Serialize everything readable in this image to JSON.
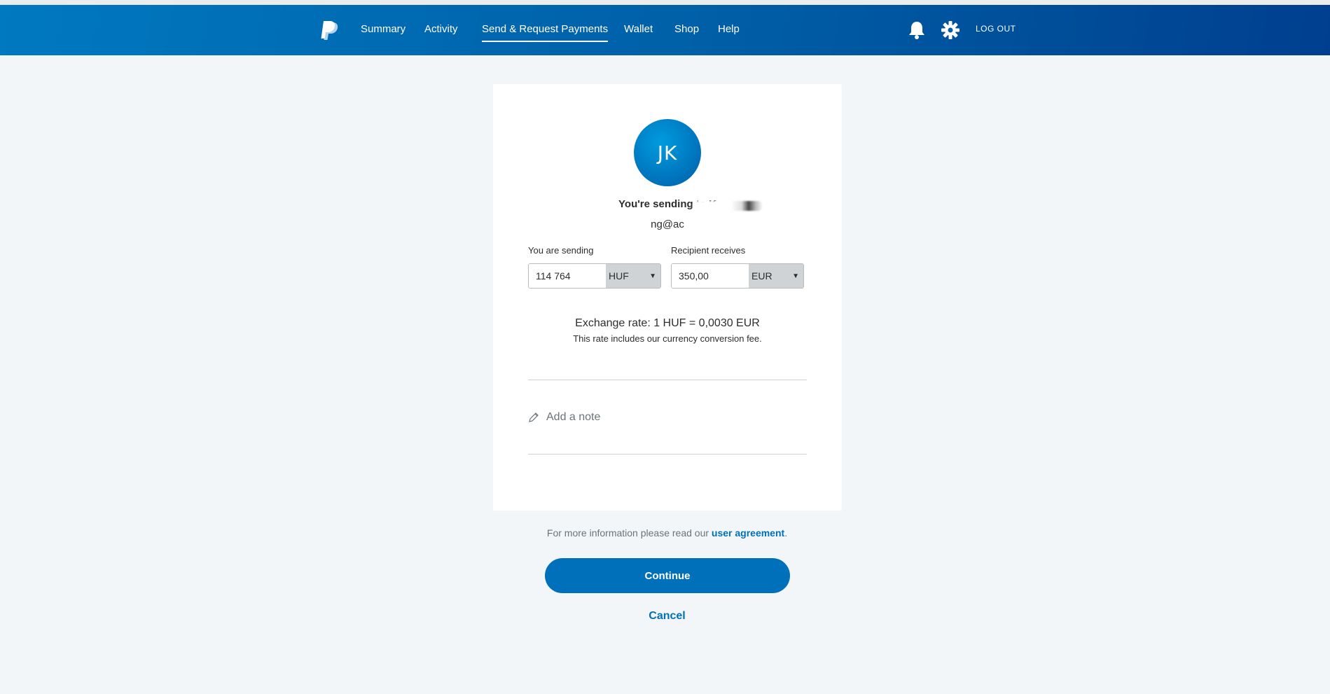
{
  "header": {
    "nav": [
      "Summary",
      "Activity",
      "Send & Request Payments",
      "Wallet",
      "Shop",
      "Help"
    ],
    "active_nav": "Send & Request Payments",
    "logout": "LOG OUT"
  },
  "recipient": {
    "initials": "JK",
    "sending_to": "You're sending to K",
    "email": "ng@ac"
  },
  "send": {
    "label": "You are sending",
    "amount": "114 764",
    "currency": "HUF"
  },
  "receive": {
    "label": "Recipient receives",
    "amount": "350,00",
    "currency": "EUR"
  },
  "exchange": {
    "rate": "Exchange rate: 1 HUF = 0,0030 EUR",
    "note": "This rate includes our currency conversion fee."
  },
  "note": {
    "label": "Add a note"
  },
  "footer": {
    "agreement_prefix": "For more information please read our ",
    "agreement_link": "user agreement",
    "agreement_suffix": ".",
    "continue": "Continue",
    "cancel": "Cancel"
  },
  "colors": {
    "header_start": "#0079c1",
    "header_end": "#003f8f",
    "primary": "#0070ba",
    "background": "#f2f6f9"
  },
  "icons": [
    "paypal-logo-icon",
    "bell-icon",
    "gear-icon",
    "pencil-icon",
    "chevron-down-icon"
  ]
}
